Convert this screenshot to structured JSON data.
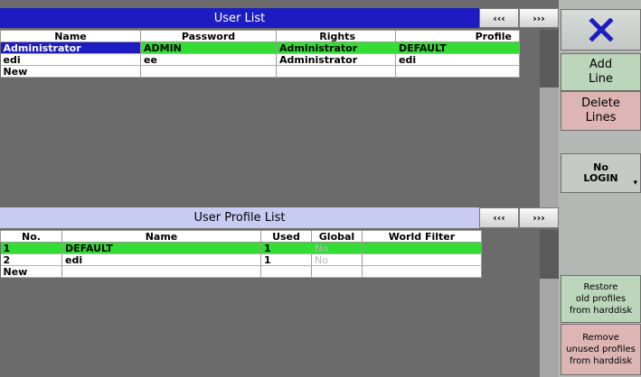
{
  "user_list": {
    "title": "User List",
    "prev_label": "‹‹‹",
    "next_label": "›››",
    "columns": [
      "Name",
      "Password",
      "Rights",
      "Profile"
    ],
    "rows": [
      {
        "name": "Administrator",
        "password": "ADMIN",
        "rights": "Administrator",
        "profile": "DEFAULT"
      },
      {
        "name": "edi",
        "password": "ee",
        "rights": "Administrator",
        "profile": "edi"
      },
      {
        "name": "New",
        "password": "",
        "rights": "",
        "profile": ""
      }
    ]
  },
  "profile_list": {
    "title": "User Profile List",
    "prev_label": "‹‹‹",
    "next_label": "›››",
    "columns": [
      "No.",
      "Name",
      "Used",
      "Global",
      "World Filter"
    ],
    "rows": [
      {
        "no": "1",
        "name": "DEFAULT",
        "used": "1",
        "global": "No",
        "filter": ""
      },
      {
        "no": "2",
        "name": "edi",
        "used": "1",
        "global": "No",
        "filter": ""
      },
      {
        "no": "New",
        "name": "",
        "used": "",
        "global": "",
        "filter": ""
      }
    ]
  },
  "side_panel": {
    "close_icon": "close-x-icon",
    "close_color": "#1c1cc2",
    "add_line": "Add\nLine",
    "delete_lines": "Delete\nLines",
    "no_login": "No\nLOGIN",
    "restore": "Restore\nold profiles\nfrom harddisk",
    "remove": "Remove\nunused profiles\nfrom harddisk"
  }
}
